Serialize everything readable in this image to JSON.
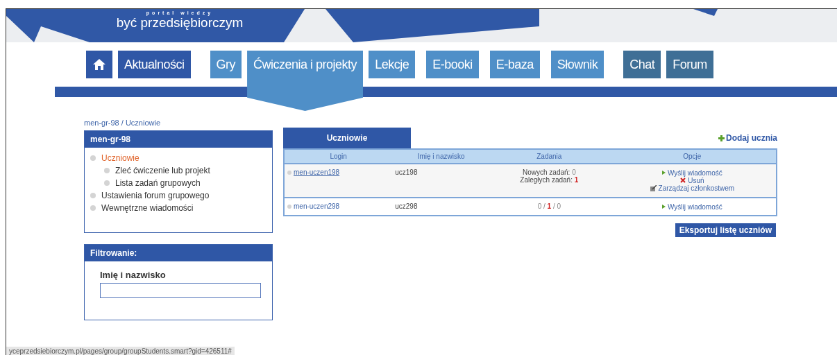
{
  "logo": {
    "tagline": "portal wiedzy",
    "name": "być przedsiębiorczym"
  },
  "nav": [
    {
      "kind": "home",
      "color": "#2f57a6",
      "selected": false
    },
    {
      "label": "Aktualności",
      "kind": "text",
      "color": "#2f57a6",
      "selected": false
    },
    {
      "label": "Gry",
      "kind": "text",
      "color": "#4f8fc8",
      "selected": false
    },
    {
      "label": "Ćwiczenia i projekty",
      "kind": "text",
      "color": "#4f8fc8",
      "selected": true
    },
    {
      "label": "Lekcje",
      "kind": "text",
      "color": "#4f8fc8",
      "selected": false
    },
    {
      "label": "E-booki",
      "kind": "text",
      "color": "#4f8fc8",
      "selected": false
    },
    {
      "label": "E-baza",
      "kind": "text",
      "color": "#4f8fc8",
      "selected": false
    },
    {
      "label": "Słownik",
      "kind": "text",
      "color": "#4f8fc8",
      "selected": false
    },
    {
      "label": "Chat",
      "kind": "text",
      "color": "#3f6f96",
      "selected": false
    },
    {
      "label": "Forum",
      "kind": "text",
      "color": "#3f6f96",
      "selected": false
    }
  ],
  "breadcrumb": "men-gr-98 / Uczniowie",
  "group_panel": {
    "title": "men-gr-98",
    "items": [
      {
        "label": "Uczniowie",
        "selected": true,
        "children": [
          {
            "label": "Zleć ćwiczenie lub projekt",
            "selected": false
          },
          {
            "label": "Lista zadań grupowych",
            "selected": false
          }
        ]
      },
      {
        "label": "Ustawienia forum grupowego",
        "selected": false
      },
      {
        "label": "Wewnętrzne wiadomości",
        "selected": false
      }
    ]
  },
  "filter_panel": {
    "title": "Filtrowanie:",
    "field_label": "Imię i nazwisko"
  },
  "tabs": [
    {
      "label": "Uczniowie",
      "selected": true
    }
  ],
  "add_link": "Dodaj ucznia",
  "table": {
    "columns": [
      "Login",
      "Imię i nazwisko",
      "Zadania",
      "Opcje"
    ],
    "rows": [
      {
        "login": "men-uczen198",
        "underlined": true,
        "name": "ucz198",
        "tasks": [
          {
            "label": "Nowych zadań: ",
            "count": "0",
            "alert": false
          },
          {
            "label": "Zaległych zadań: ",
            "count": "1",
            "alert": true
          }
        ],
        "options": [
          {
            "kind": "message",
            "label": "Wyślij wiadomość"
          },
          {
            "kind": "delete",
            "label": "Usuń"
          },
          {
            "kind": "manage",
            "label": "Zarządzaj członkostwem"
          }
        ]
      },
      {
        "login": "men-uczen298",
        "underlined": false,
        "name": "ucz298",
        "task_counts": "0 / **1** / 0",
        "options": [
          {
            "kind": "message",
            "label": "Wyślij wiadomość"
          }
        ]
      }
    ]
  },
  "export_button": "Eksportuj listę uczniów",
  "status_bar": "yceprzedsiebiorczym.pl/pages/group/groupStudents.smart?gid=426511#"
}
